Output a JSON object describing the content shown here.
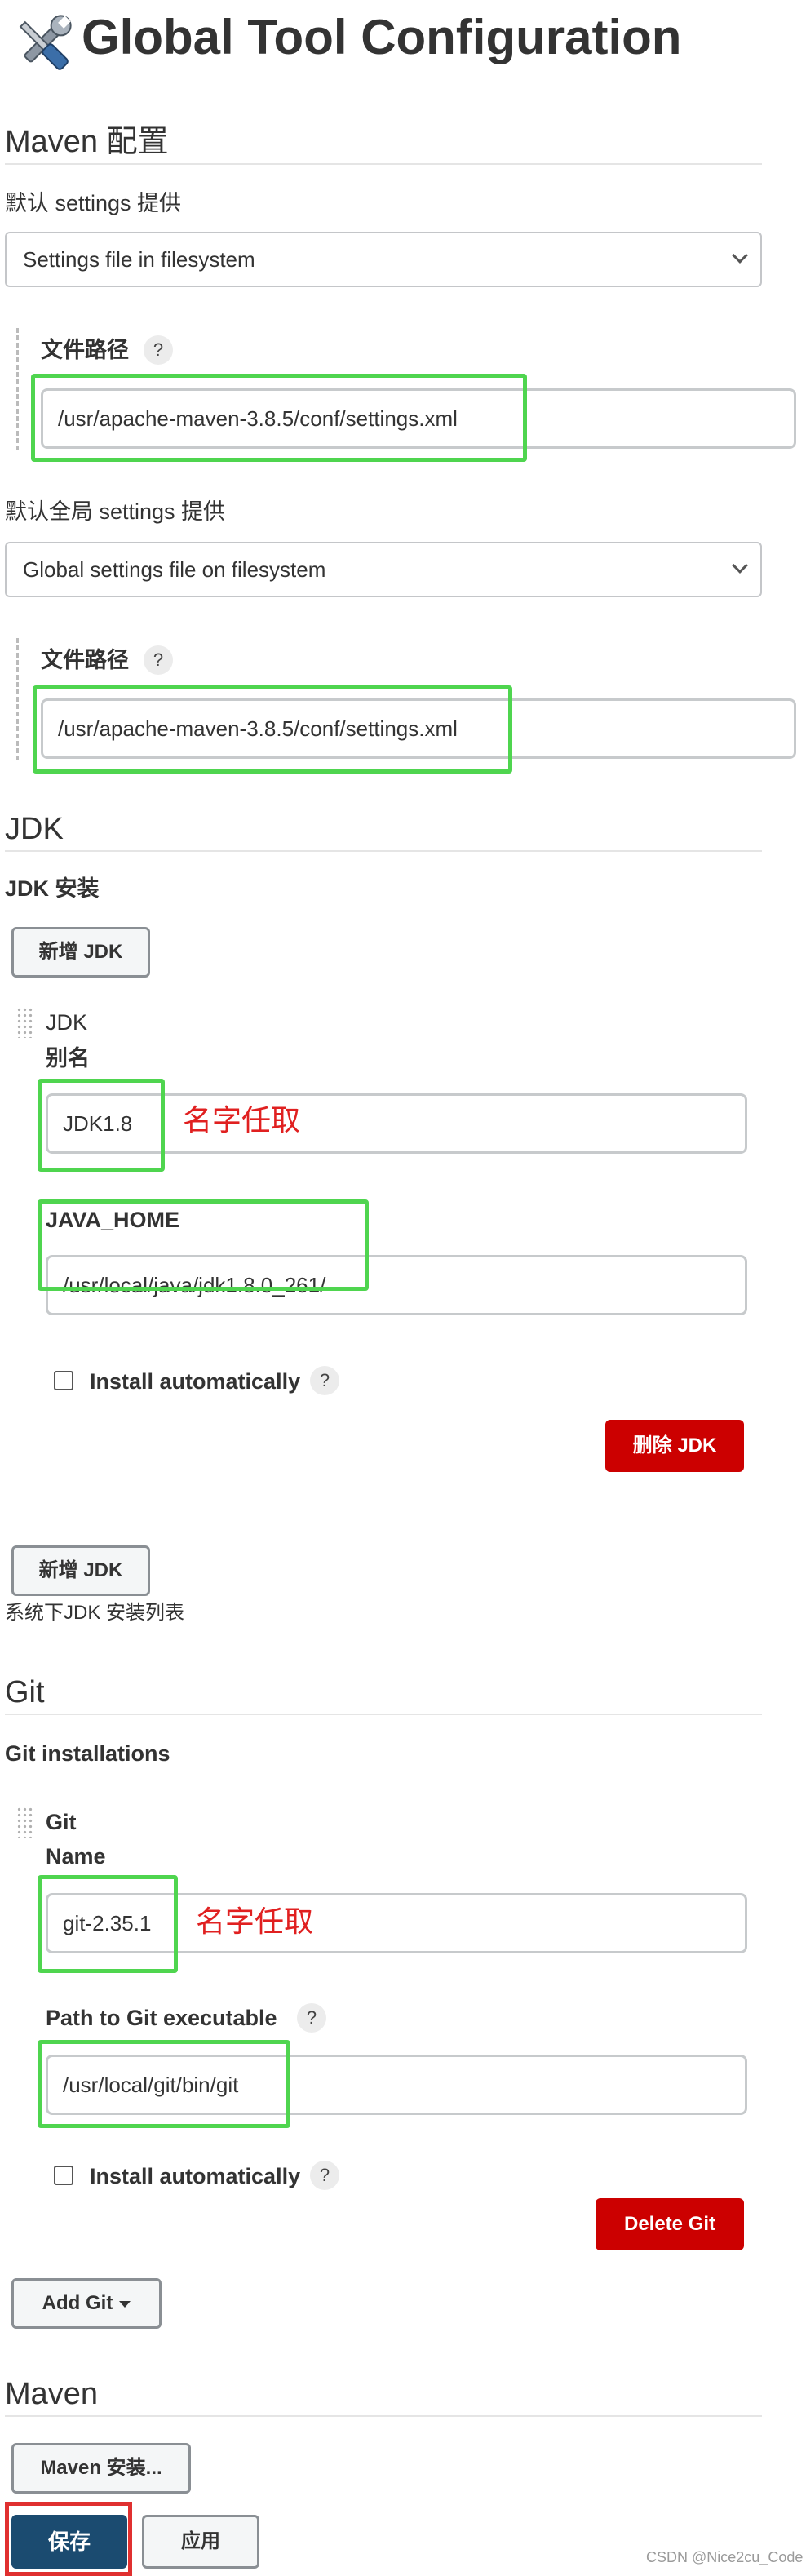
{
  "header": {
    "title": "Global Tool Configuration",
    "icon": "tools-icon"
  },
  "maven_config": {
    "section_title": "Maven 配置",
    "settings_label": "默认 settings 提供",
    "settings_select": "Settings file in filesystem",
    "settings_path_label": "文件路径",
    "settings_path_value": "/usr/apache-maven-3.8.5/conf/settings.xml",
    "global_settings_label": "默认全局 settings 提供",
    "global_settings_select": "Global settings file on filesystem",
    "global_path_label": "文件路径",
    "global_path_value": "/usr/apache-maven-3.8.5/conf/settings.xml",
    "help_symbol": "?"
  },
  "jdk": {
    "section_title": "JDK",
    "installs_label": "JDK 安装",
    "add_button": "新增 JDK",
    "item_title": "JDK",
    "alias_label": "别名",
    "alias_value": "JDK1.8",
    "alias_annotation": "名字任取",
    "java_home_label": "JAVA_HOME",
    "java_home_value": "/usr/local/java/jdk1.8.0_261/",
    "install_auto_label": "Install automatically",
    "delete_button": "删除 JDK",
    "add_button_2": "新增 JDK",
    "list_caption": "系统下JDK 安装列表"
  },
  "git": {
    "section_title": "Git",
    "installs_label": "Git installations",
    "item_title": "Git",
    "name_label": "Name",
    "name_value": "git-2.35.1",
    "name_annotation": "名字任取",
    "path_label": "Path to Git executable",
    "path_value": "/usr/local/git/bin/git",
    "install_auto_label": "Install automatically",
    "delete_button": "Delete Git",
    "add_button": "Add Git"
  },
  "maven": {
    "section_title": "Maven",
    "install_button": "Maven 安装..."
  },
  "footer": {
    "save_button": "保存",
    "apply_button": "应用",
    "watermark": "CSDN @Nice2cu_Code"
  },
  "colors": {
    "highlight_green": "#4fd54f",
    "highlight_red": "#e03030",
    "danger": "#cc0000",
    "primary": "#1b4b70",
    "annotation": "#e02020"
  }
}
